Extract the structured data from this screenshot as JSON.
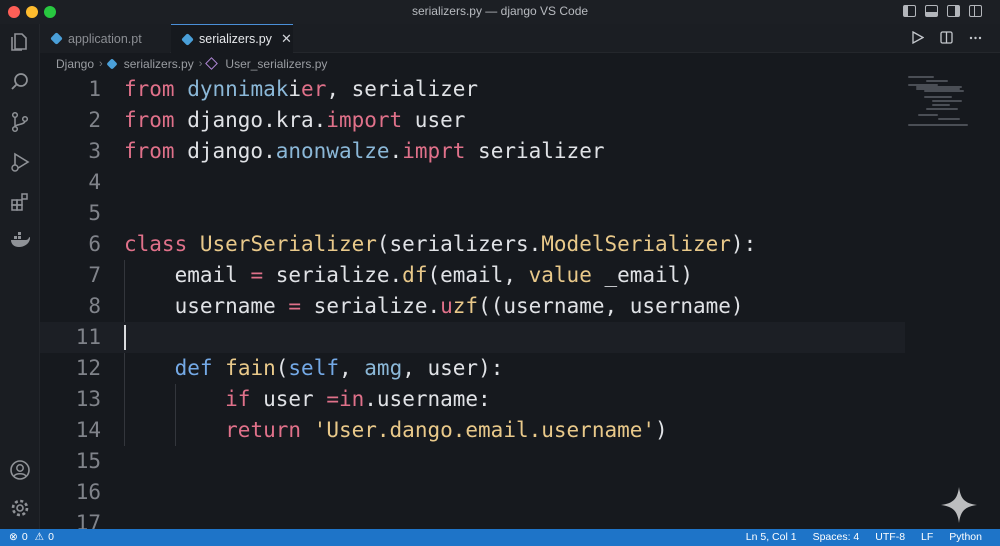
{
  "window": {
    "title": "serializers.py — django VS Code"
  },
  "tabs": [
    {
      "label": "application.pt"
    },
    {
      "label": "serializers.py",
      "close": "✕"
    }
  ],
  "breadcrumb": {
    "root": "Django",
    "file": "serializers.py",
    "symbol": "User_serializers.py"
  },
  "editor": {
    "lines": [
      {
        "num": "1",
        "tokens": [
          [
            "kw",
            "from"
          ],
          [
            "plain",
            " "
          ],
          [
            "mod",
            "dynnimak"
          ],
          [
            "plain",
            "i"
          ],
          [
            "kw",
            "er"
          ],
          [
            "plain",
            ", serializer"
          ]
        ]
      },
      {
        "num": "2",
        "tokens": [
          [
            "kw",
            "from"
          ],
          [
            "plain",
            " django.kra."
          ],
          [
            "kw",
            "import"
          ],
          [
            "plain",
            " user"
          ]
        ]
      },
      {
        "num": "3",
        "tokens": [
          [
            "kw",
            "from"
          ],
          [
            "plain",
            " django."
          ],
          [
            "mod",
            "anonwalze"
          ],
          [
            "plain",
            "."
          ],
          [
            "kw",
            "imprt"
          ],
          [
            "plain",
            " serializer"
          ]
        ]
      },
      {
        "num": "4",
        "tokens": []
      },
      {
        "num": "5",
        "tokens": []
      },
      {
        "num": "6",
        "tokens": [
          [
            "kw",
            "class"
          ],
          [
            "plain",
            " "
          ],
          [
            "cls",
            "UserSerializer"
          ],
          [
            "plain",
            "(serializers."
          ],
          [
            "cls",
            "ModelSerializer"
          ],
          [
            "plain",
            "):"
          ]
        ]
      },
      {
        "num": "7",
        "tokens": [
          [
            "plain",
            "    email "
          ],
          [
            "op",
            "="
          ],
          [
            "plain",
            " serialize."
          ],
          [
            "fn",
            "df"
          ],
          [
            "plain",
            "(email, "
          ],
          [
            "str",
            "value"
          ],
          [
            "plain",
            " _email)"
          ]
        ]
      },
      {
        "num": "8",
        "tokens": [
          [
            "plain",
            "    username "
          ],
          [
            "op",
            "="
          ],
          [
            "plain",
            " serialize."
          ],
          [
            "kw",
            "u"
          ],
          [
            "fn",
            "zf"
          ],
          [
            "plain",
            "((username, username)"
          ]
        ]
      },
      {
        "num": "11",
        "tokens": []
      },
      {
        "num": "12",
        "tokens": [
          [
            "plain",
            "    "
          ],
          [
            "kw-b",
            "def"
          ],
          [
            "plain",
            " "
          ],
          [
            "fn",
            "fain"
          ],
          [
            "plain",
            "("
          ],
          [
            "kw-b",
            "self"
          ],
          [
            "plain",
            ", "
          ],
          [
            "mod",
            "amg"
          ],
          [
            "plain",
            ", user):"
          ]
        ]
      },
      {
        "num": "13",
        "tokens": [
          [
            "plain",
            "        "
          ],
          [
            "kw",
            "if"
          ],
          [
            "plain",
            " user "
          ],
          [
            "op",
            "="
          ],
          [
            "kw",
            "in"
          ],
          [
            "plain",
            ".username:"
          ]
        ]
      },
      {
        "num": "14",
        "tokens": [
          [
            "plain",
            "        "
          ],
          [
            "kw",
            "return"
          ],
          [
            "plain",
            " "
          ],
          [
            "str",
            "'User.dango.email.username'"
          ],
          [
            "plain",
            ")"
          ]
        ]
      },
      {
        "num": "15",
        "tokens": []
      },
      {
        "num": "16",
        "tokens": []
      },
      {
        "num": "17",
        "tokens": []
      }
    ]
  },
  "statusbar": {
    "errors": "0",
    "warnings": "0",
    "position": "Ln 5, Col 1",
    "spaces": "Spaces: 4",
    "encoding": "UTF-8",
    "eol": "LF",
    "language": "Python"
  },
  "colors": {
    "accent": "#1e74c8",
    "keyword": "#e0718a",
    "class": "#e9c98a"
  }
}
